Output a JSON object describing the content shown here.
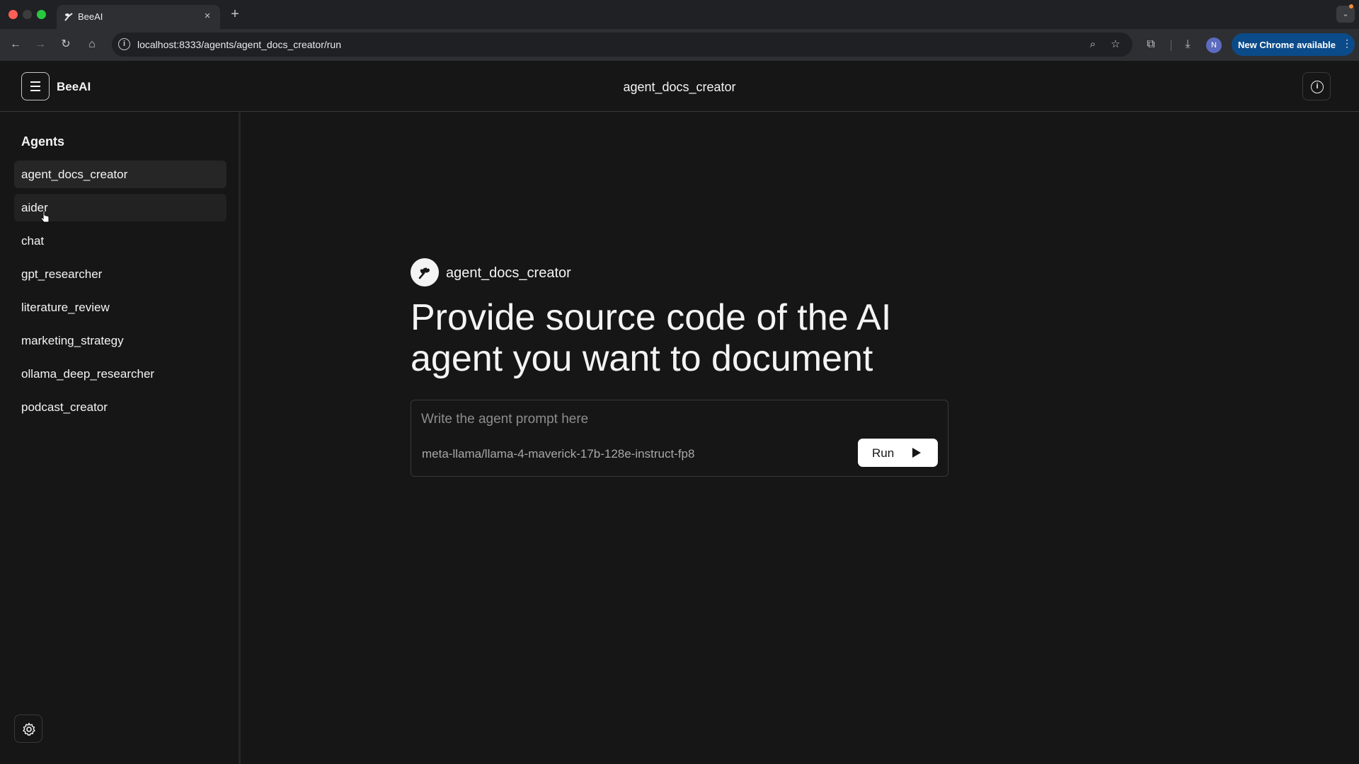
{
  "browser": {
    "tab_title": "BeeAI",
    "tab_close": "×",
    "new_tab": "+",
    "url": "localhost:8333/agents/agent_docs_creator/run",
    "profile_initial": "N",
    "update_button": "New Chrome available",
    "icons": [
      "back-icon",
      "forward-icon",
      "reload-icon",
      "home-icon",
      "site-info-icon",
      "zoom-icon",
      "bookmark-star-icon",
      "extensions-icon",
      "download-icon",
      "more-vert-icon"
    ]
  },
  "app": {
    "brand": "BeeAI",
    "header_title": "agent_docs_creator"
  },
  "sidebar": {
    "heading": "Agents",
    "items": [
      {
        "label": "agent_docs_creator",
        "state": "active"
      },
      {
        "label": "aider",
        "state": "hover"
      },
      {
        "label": "chat"
      },
      {
        "label": "gpt_researcher"
      },
      {
        "label": "literature_review"
      },
      {
        "label": "marketing_strategy"
      },
      {
        "label": "ollama_deep_researcher"
      },
      {
        "label": "podcast_creator"
      }
    ]
  },
  "main": {
    "agent_name": "agent_docs_creator",
    "heading": "Provide source code of the AI agent you want to document",
    "prompt_placeholder": "Write the agent prompt here",
    "model": "meta-llama/llama-4-maverick-17b-128e-instruct-fp8",
    "run_label": "Run"
  },
  "colors": {
    "background": "#161616",
    "text": "#f4f4f4",
    "border": "#393939",
    "active_item": "#262626",
    "update_button": "#0b4b8a"
  }
}
